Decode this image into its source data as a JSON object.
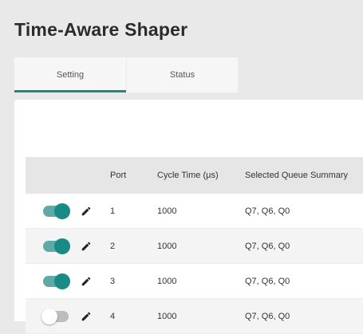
{
  "page": {
    "title": "Time-Aware Shaper"
  },
  "tabs": [
    {
      "label": "Setting",
      "active": true
    },
    {
      "label": "Status",
      "active": false
    }
  ],
  "table": {
    "headers": {
      "port": "Port",
      "cycle": "Cycle Time (μs)",
      "queue": "Selected Queue Summary"
    },
    "rows": [
      {
        "enabled": true,
        "port": "1",
        "cycle": "1000",
        "queue": "Q7, Q6, Q0"
      },
      {
        "enabled": true,
        "port": "2",
        "cycle": "1000",
        "queue": "Q7, Q6, Q0"
      },
      {
        "enabled": true,
        "port": "3",
        "cycle": "1000",
        "queue": "Q7, Q6, Q0"
      },
      {
        "enabled": false,
        "port": "4",
        "cycle": "1000",
        "queue": "Q7, Q6, Q0"
      }
    ]
  },
  "colors": {
    "accent": "#1a8a86",
    "toggle_track_on": "#5fa9a6",
    "toggle_off": "#bdbdbd"
  },
  "icons": {
    "edit": "pencil-icon"
  }
}
